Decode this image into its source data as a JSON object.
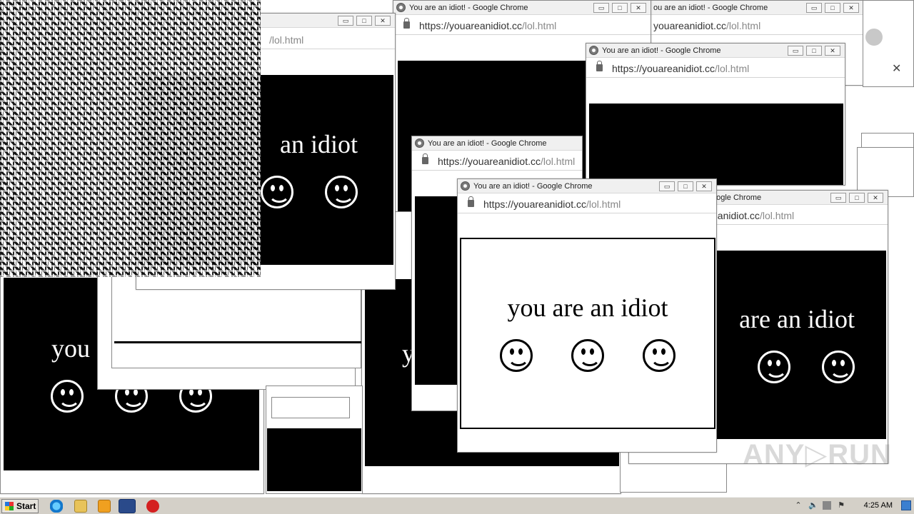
{
  "window_title": "You are an idiot! - Google Chrome",
  "window_title_partial_1": "ou are an idiot! - Google Chrome",
  "window_title_partial_2": "oogle Chrome",
  "url_host": "https://youareanidiot.cc",
  "url_path": "/lol.html",
  "url_host_partial": "youareanidiot.cc",
  "url_host_partial_2": "eanidiot.cc",
  "url_path_only": "/lol.html",
  "phrase": "you are an idiot",
  "phrase_partial_1": "an idiot",
  "phrase_partial_2": "are an idiot",
  "phrase_partial_3": "you",
  "window_buttons": {
    "minimize": "▭",
    "maximize": "□",
    "close": "✕"
  },
  "close_x": "✕",
  "taskbar": {
    "start_label": "Start",
    "clock": "4:25 AM"
  },
  "watermark": "ANY▷RUN",
  "icons": [
    "chrome-icon",
    "lock-icon",
    "smiley-icon",
    "start-flag-icon",
    "ie-icon",
    "explorer-icon",
    "media-player-icon",
    "chrome-taskbar-icon",
    "stop-icon",
    "volume-icon",
    "network-icon",
    "flag-icon"
  ],
  "colors": {
    "panel_black": "#000000",
    "taskbar": "#d4d0c8",
    "accent": "#3b7fd0"
  }
}
